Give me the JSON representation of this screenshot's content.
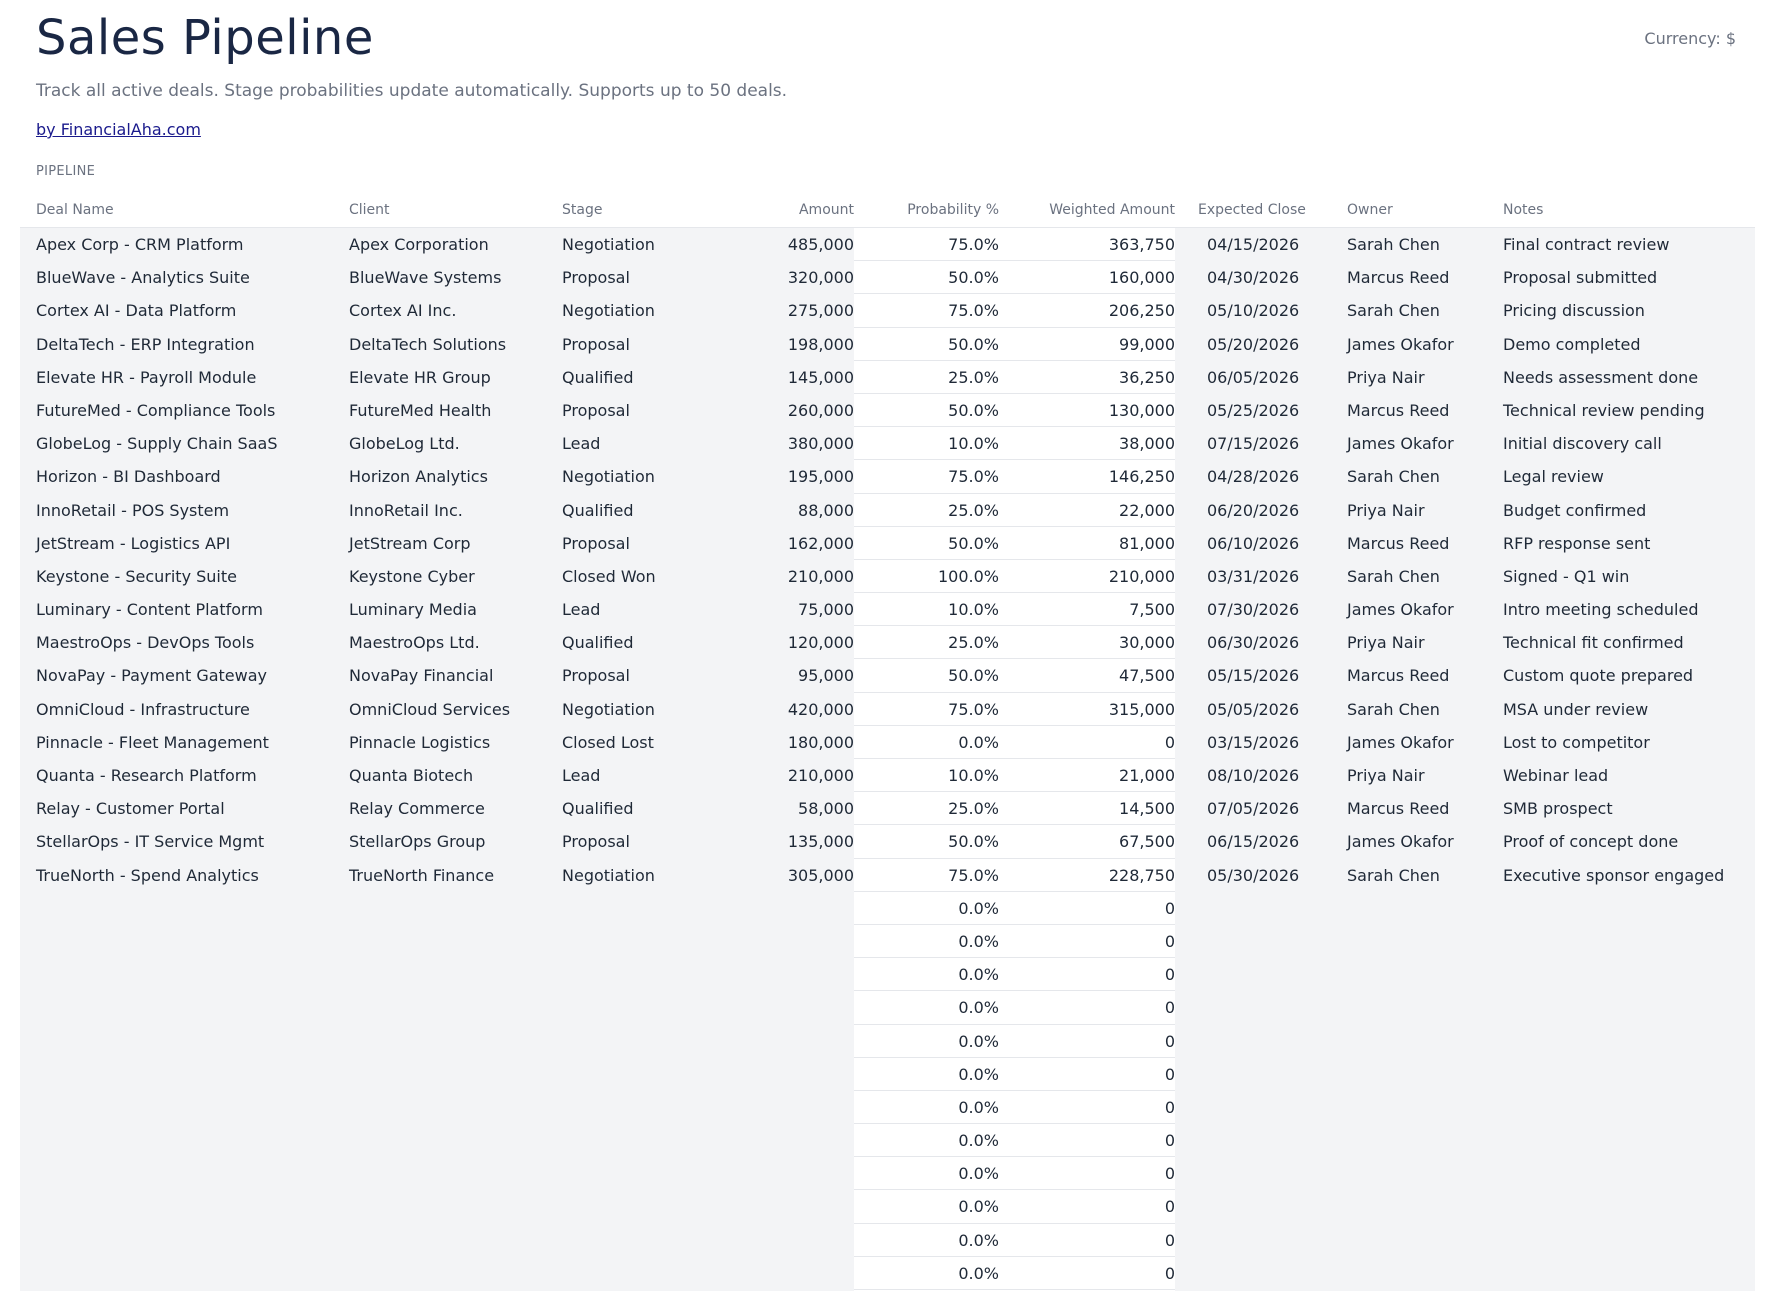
{
  "header": {
    "title": "Sales Pipeline",
    "currency": "Currency: $",
    "subtitle": "Track all active deals. Stage probabilities update automatically. Supports up to 50 deals.",
    "credit": "by FinancialAha.com"
  },
  "table": {
    "section_label": "PIPELINE",
    "columns": [
      "Deal Name",
      "Client",
      "Stage",
      "Amount",
      "Probability %",
      "Weighted Amount",
      "Expected Close",
      "Owner",
      "Notes"
    ],
    "rows": [
      [
        "Apex Corp - CRM Platform",
        "Apex Corporation",
        "Negotiation",
        "485,000",
        "75.0%",
        "363,750",
        "04/15/2026",
        "Sarah Chen",
        "Final contract review"
      ],
      [
        "BlueWave - Analytics Suite",
        "BlueWave Systems",
        "Proposal",
        "320,000",
        "50.0%",
        "160,000",
        "04/30/2026",
        "Marcus Reed",
        "Proposal submitted"
      ],
      [
        "Cortex AI - Data Platform",
        "Cortex AI Inc.",
        "Negotiation",
        "275,000",
        "75.0%",
        "206,250",
        "05/10/2026",
        "Sarah Chen",
        "Pricing discussion"
      ],
      [
        "DeltaTech - ERP Integration",
        "DeltaTech Solutions",
        "Proposal",
        "198,000",
        "50.0%",
        "99,000",
        "05/20/2026",
        "James Okafor",
        "Demo completed"
      ],
      [
        "Elevate HR - Payroll Module",
        "Elevate HR Group",
        "Qualified",
        "145,000",
        "25.0%",
        "36,250",
        "06/05/2026",
        "Priya Nair",
        "Needs assessment done"
      ],
      [
        "FutureMed - Compliance Tools",
        "FutureMed Health",
        "Proposal",
        "260,000",
        "50.0%",
        "130,000",
        "05/25/2026",
        "Marcus Reed",
        "Technical review pending"
      ],
      [
        "GlobeLog - Supply Chain SaaS",
        "GlobeLog Ltd.",
        "Lead",
        "380,000",
        "10.0%",
        "38,000",
        "07/15/2026",
        "James Okafor",
        "Initial discovery call"
      ],
      [
        "Horizon - BI Dashboard",
        "Horizon Analytics",
        "Negotiation",
        "195,000",
        "75.0%",
        "146,250",
        "04/28/2026",
        "Sarah Chen",
        "Legal review"
      ],
      [
        "InnoRetail - POS System",
        "InnoRetail Inc.",
        "Qualified",
        "88,000",
        "25.0%",
        "22,000",
        "06/20/2026",
        "Priya Nair",
        "Budget confirmed"
      ],
      [
        "JetStream - Logistics API",
        "JetStream Corp",
        "Proposal",
        "162,000",
        "50.0%",
        "81,000",
        "06/10/2026",
        "Marcus Reed",
        "RFP response sent"
      ],
      [
        "Keystone - Security Suite",
        "Keystone Cyber",
        "Closed Won",
        "210,000",
        "100.0%",
        "210,000",
        "03/31/2026",
        "Sarah Chen",
        "Signed - Q1 win"
      ],
      [
        "Luminary - Content Platform",
        "Luminary Media",
        "Lead",
        "75,000",
        "10.0%",
        "7,500",
        "07/30/2026",
        "James Okafor",
        "Intro meeting scheduled"
      ],
      [
        "MaestroOps - DevOps Tools",
        "MaestroOps Ltd.",
        "Qualified",
        "120,000",
        "25.0%",
        "30,000",
        "06/30/2026",
        "Priya Nair",
        "Technical fit confirmed"
      ],
      [
        "NovaPay - Payment Gateway",
        "NovaPay Financial",
        "Proposal",
        "95,000",
        "50.0%",
        "47,500",
        "05/15/2026",
        "Marcus Reed",
        "Custom quote prepared"
      ],
      [
        "OmniCloud - Infrastructure",
        "OmniCloud Services",
        "Negotiation",
        "420,000",
        "75.0%",
        "315,000",
        "05/05/2026",
        "Sarah Chen",
        "MSA under review"
      ],
      [
        "Pinnacle - Fleet Management",
        "Pinnacle Logistics",
        "Closed Lost",
        "180,000",
        "0.0%",
        "0",
        "03/15/2026",
        "James Okafor",
        "Lost to competitor"
      ],
      [
        "Quanta - Research Platform",
        "Quanta Biotech",
        "Lead",
        "210,000",
        "10.0%",
        "21,000",
        "08/10/2026",
        "Priya Nair",
        "Webinar lead"
      ],
      [
        "Relay - Customer Portal",
        "Relay Commerce",
        "Qualified",
        "58,000",
        "25.0%",
        "14,500",
        "07/05/2026",
        "Marcus Reed",
        "SMB prospect"
      ],
      [
        "StellarOps - IT Service Mgmt",
        "StellarOps Group",
        "Proposal",
        "135,000",
        "50.0%",
        "67,500",
        "06/15/2026",
        "James Okafor",
        "Proof of concept done"
      ],
      [
        "TrueNorth - Spend Analytics",
        "TrueNorth Finance",
        "Negotiation",
        "305,000",
        "75.0%",
        "228,750",
        "05/30/2026",
        "Sarah Chen",
        "Executive sponsor engaged"
      ],
      [
        "",
        "",
        "",
        "",
        "0.0%",
        "0",
        "",
        "",
        ""
      ],
      [
        "",
        "",
        "",
        "",
        "0.0%",
        "0",
        "",
        "",
        ""
      ],
      [
        "",
        "",
        "",
        "",
        "0.0%",
        "0",
        "",
        "",
        ""
      ],
      [
        "",
        "",
        "",
        "",
        "0.0%",
        "0",
        "",
        "",
        ""
      ],
      [
        "",
        "",
        "",
        "",
        "0.0%",
        "0",
        "",
        "",
        ""
      ],
      [
        "",
        "",
        "",
        "",
        "0.0%",
        "0",
        "",
        "",
        ""
      ],
      [
        "",
        "",
        "",
        "",
        "0.0%",
        "0",
        "",
        "",
        ""
      ],
      [
        "",
        "",
        "",
        "",
        "0.0%",
        "0",
        "",
        "",
        ""
      ],
      [
        "",
        "",
        "",
        "",
        "0.0%",
        "0",
        "",
        "",
        ""
      ],
      [
        "",
        "",
        "",
        "",
        "0.0%",
        "0",
        "",
        "",
        ""
      ],
      [
        "",
        "",
        "",
        "",
        "0.0%",
        "0",
        "",
        "",
        ""
      ],
      [
        "",
        "",
        "",
        "",
        "0.0%",
        "0",
        "",
        "",
        ""
      ]
    ]
  }
}
